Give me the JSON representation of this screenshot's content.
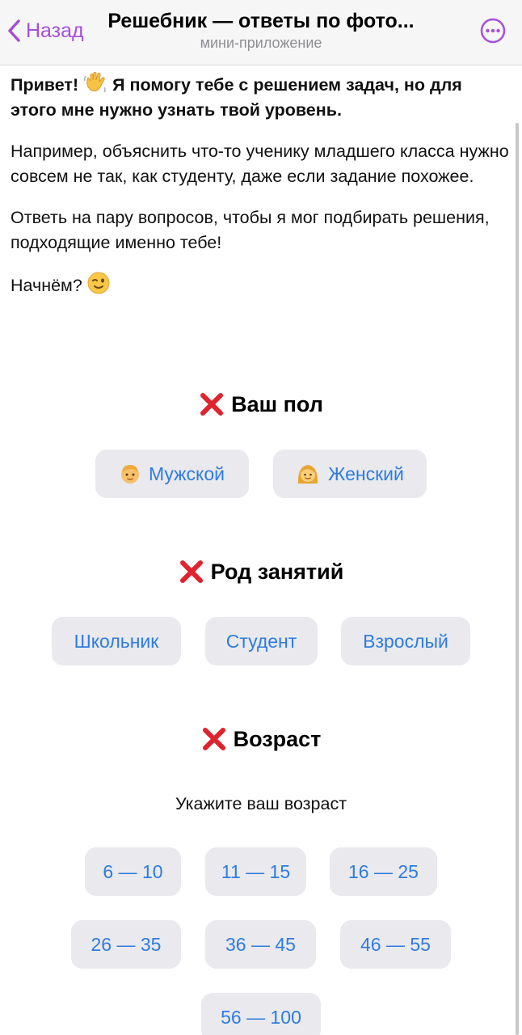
{
  "header": {
    "back_label": "Назад",
    "title": "Решебник — ответы по фото...",
    "subtitle": "мини-приложение",
    "accent": "#a64fd8"
  },
  "intro": {
    "greeting_a": "Привет!",
    "greeting_b": "Я помогу тебе с решением задач, но для этого мне нужно узнать твой уровень.",
    "paragraph_1": "Например, объяснить что-то ученику младшего класса нужно совсем не так, как студенту, даже если задание похожее.",
    "paragraph_2": "Ответь на пару вопросов, чтобы я мог подбирать решения, подходящие именно тебе!",
    "paragraph_3": "Начнём?"
  },
  "gender": {
    "title": "Ваш пол",
    "options": [
      {
        "label": "Мужской",
        "icon": "boy-emoji-icon"
      },
      {
        "label": "Женский",
        "icon": "woman-emoji-icon"
      }
    ]
  },
  "occupation": {
    "title": "Род занятий",
    "options": [
      "Школьник",
      "Студент",
      "Взрослый"
    ]
  },
  "age": {
    "title": "Возраст",
    "hint": "Укажите ваш возраст",
    "options": [
      "6 — 10",
      "11 — 15",
      "16 — 25",
      "26 — 35",
      "36 — 45",
      "46 — 55",
      "56 — 100"
    ]
  },
  "colors": {
    "button_bg": "#e9e9ee",
    "button_text": "#2e7ce0",
    "cross": "#e0232d"
  }
}
